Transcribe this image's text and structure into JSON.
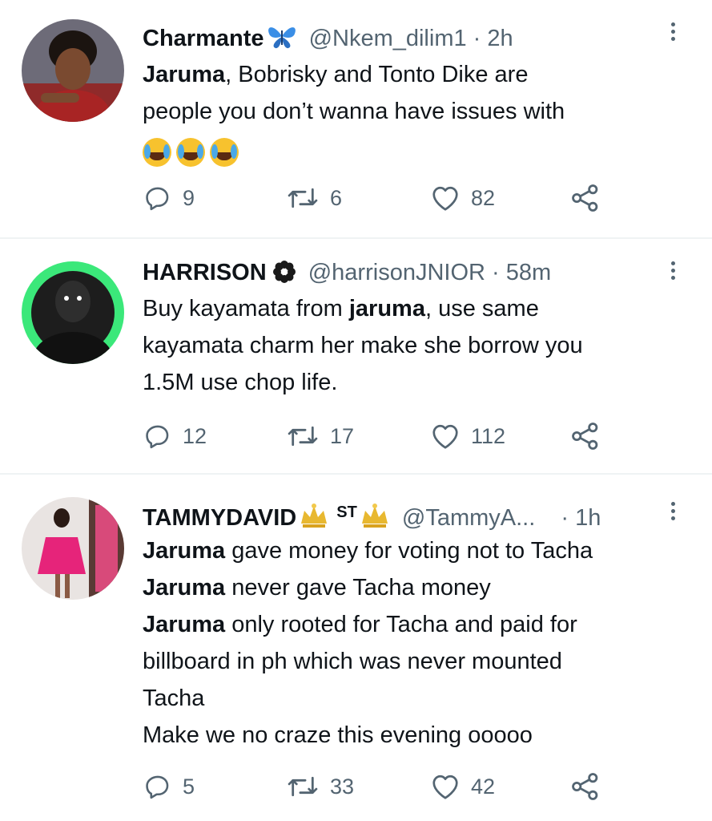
{
  "tweets": [
    {
      "name": "Charmante",
      "name_emoji": "🦋",
      "handle": "@Nkem_dilim1",
      "time": "2h",
      "lines": [
        [
          {
            "t": "Jaruma",
            "b": true
          },
          {
            "t": ", Bobrisky and Tonto Dike are",
            "b": false
          }
        ],
        [
          {
            "t": "people you don’t wanna have issues with",
            "b": false
          }
        ]
      ],
      "emojis": [
        "😂",
        "😂",
        "😂"
      ],
      "replies": "9",
      "retweets": "6",
      "likes": "82"
    },
    {
      "name": "HARRISON",
      "name_emoji": "",
      "handle": "@harrisonJNIOR",
      "time": "58m",
      "lines": [
        [
          {
            "t": "Buy kayamata from ",
            "b": false
          },
          {
            "t": "jaruma",
            "b": true
          },
          {
            "t": ", use same",
            "b": false
          }
        ],
        [
          {
            "t": "kayamata charm her make she borrow you",
            "b": false
          }
        ],
        [
          {
            "t": "1.5M use chop life.",
            "b": false
          }
        ]
      ],
      "emojis": [],
      "replies": "12",
      "retweets": "17",
      "likes": "112"
    },
    {
      "name": "TAMMYDAVID",
      "name_emoji": "ST",
      "handle": "@TammyA...",
      "time": "1h",
      "lines": [
        [
          {
            "t": "Jaruma",
            "b": true
          },
          {
            "t": " gave money for voting not to Tacha",
            "b": false
          }
        ],
        [
          {
            "t": "Jaruma",
            "b": true
          },
          {
            "t": " never gave Tacha money",
            "b": false
          }
        ],
        [
          {
            "t": "Jaruma",
            "b": true
          },
          {
            "t": " only rooted for Tacha and paid for",
            "b": false
          }
        ],
        [
          {
            "t": "billboard in ph which was never mounted",
            "b": false
          }
        ],
        [
          {
            "t": "Tacha",
            "b": false
          }
        ],
        [
          {
            "t": "Make we no craze this evening ooooo",
            "b": false
          }
        ]
      ],
      "emojis": [],
      "replies": "5",
      "retweets": "33",
      "likes": "42"
    }
  ],
  "colors": {
    "text": "#0f1419",
    "secondary": "#536471",
    "divider": "#eff3f4",
    "emoji_yellow": "#f7c22e",
    "crown_gold": "#e8b830",
    "avatar2_ring": "#3be87a"
  },
  "icons": [
    "reply-icon",
    "retweet-icon",
    "like-icon",
    "share-icon",
    "more-icon",
    "butterfly-icon",
    "flower-badge-icon",
    "crown-icon"
  ]
}
